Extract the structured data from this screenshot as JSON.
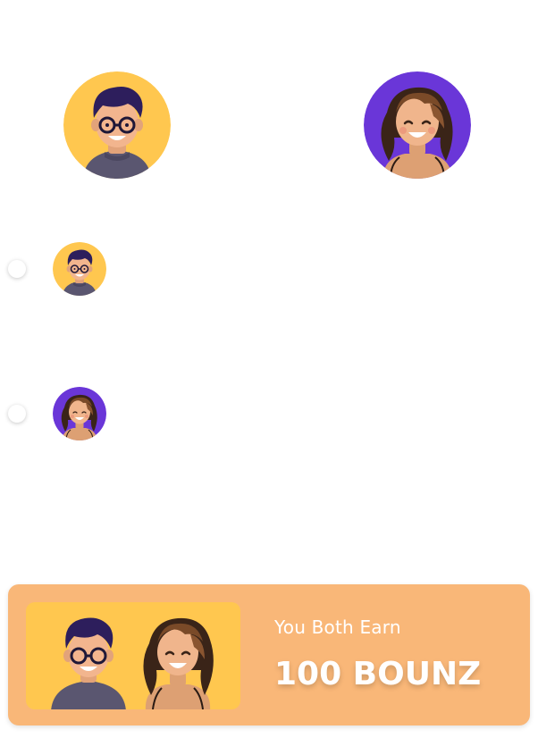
{
  "colors": {
    "background": "#ffffff",
    "card": "#F9B778",
    "avatar_yellow": "#FFC74F",
    "avatar_purple": "#6A36D8",
    "text_on_card": "#ffffff"
  },
  "header": {
    "referrer_avatar": {
      "icon": "boy-avatar-icon"
    },
    "referee_avatar": {
      "icon": "girl-avatar-icon"
    }
  },
  "options": [
    {
      "icon": "boy-avatar-icon",
      "selected": false
    },
    {
      "icon": "girl-avatar-icon",
      "selected": false
    }
  ],
  "reward": {
    "label": "You Both Earn",
    "amount": "100 BOUNZ"
  }
}
